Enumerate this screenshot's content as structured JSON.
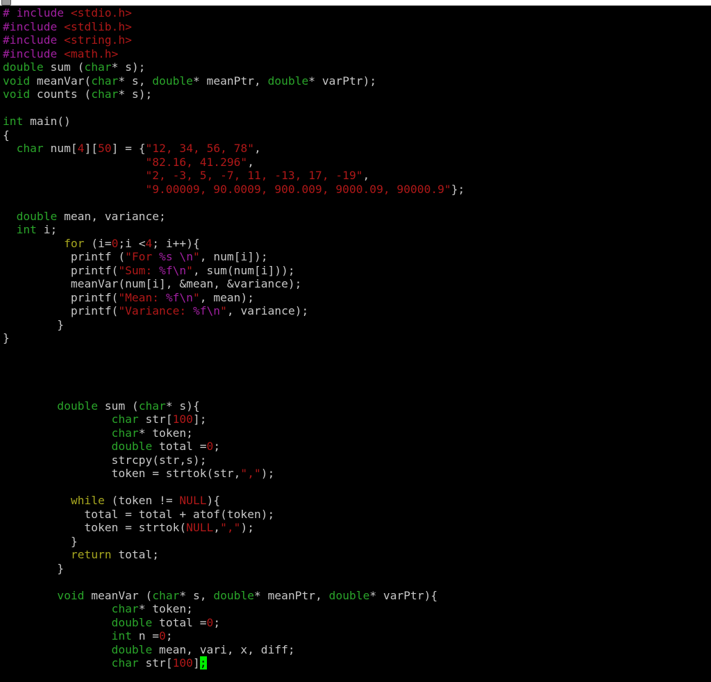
{
  "window": {
    "title": "",
    "app_icon": "terminal-window-icon"
  },
  "editor": {
    "theme_colors": {
      "background": "#000000",
      "text": "#c8c8c8",
      "type": "#2aa52a",
      "preproc": "#a020a0",
      "string": "#b01818",
      "special": "#a020a0",
      "keyword": "#a8a820",
      "cursor": "#00ee00"
    },
    "cursor": {
      "line": 49,
      "column": 26,
      "char": ";"
    },
    "lines": [
      [
        [
          "preproc",
          "# include "
        ],
        [
          "string",
          "<stdio.h>"
        ]
      ],
      [
        [
          "preproc",
          "#include "
        ],
        [
          "string",
          "<stdlib.h>"
        ]
      ],
      [
        [
          "preproc",
          "#include "
        ],
        [
          "string",
          "<string.h>"
        ]
      ],
      [
        [
          "preproc",
          "#include "
        ],
        [
          "string",
          "<math.h>"
        ]
      ],
      [
        [
          "type",
          "double"
        ],
        [
          "text",
          " sum ("
        ],
        [
          "type",
          "char"
        ],
        [
          "text",
          "* s);"
        ]
      ],
      [
        [
          "type",
          "void"
        ],
        [
          "text",
          " meanVar("
        ],
        [
          "type",
          "char"
        ],
        [
          "text",
          "* s, "
        ],
        [
          "type",
          "double"
        ],
        [
          "text",
          "* meanPtr, "
        ],
        [
          "type",
          "double"
        ],
        [
          "text",
          "* varPtr);"
        ]
      ],
      [
        [
          "type",
          "void"
        ],
        [
          "text",
          " counts ("
        ],
        [
          "type",
          "char"
        ],
        [
          "text",
          "* s);"
        ]
      ],
      [],
      [
        [
          "type",
          "int"
        ],
        [
          "text",
          " main()"
        ]
      ],
      [
        [
          "text",
          "{"
        ]
      ],
      [
        [
          "text",
          "  "
        ],
        [
          "type",
          "char"
        ],
        [
          "text",
          " num["
        ],
        [
          "number",
          "4"
        ],
        [
          "text",
          "]["
        ],
        [
          "number",
          "50"
        ],
        [
          "text",
          "] = {"
        ],
        [
          "string",
          "\"12, 34, 56, 78\""
        ],
        [
          "text",
          ","
        ]
      ],
      [
        [
          "text",
          "                     "
        ],
        [
          "string",
          "\"82.16, 41.296\""
        ],
        [
          "text",
          ","
        ]
      ],
      [
        [
          "text",
          "                     "
        ],
        [
          "string",
          "\"2, -3, 5, -7, 11, -13, 17, -19\""
        ],
        [
          "text",
          ","
        ]
      ],
      [
        [
          "text",
          "                     "
        ],
        [
          "string",
          "\"9.00009, 90.0009, 900.009, 9000.09, 90000.9\""
        ],
        [
          "text",
          "};"
        ]
      ],
      [],
      [
        [
          "text",
          "  "
        ],
        [
          "type",
          "double"
        ],
        [
          "text",
          " mean, variance;"
        ]
      ],
      [
        [
          "text",
          "  "
        ],
        [
          "type",
          "int"
        ],
        [
          "text",
          " i;"
        ]
      ],
      [
        [
          "text",
          "         "
        ],
        [
          "keyword",
          "for"
        ],
        [
          "text",
          " (i="
        ],
        [
          "number",
          "0"
        ],
        [
          "text",
          ";i <"
        ],
        [
          "number",
          "4"
        ],
        [
          "text",
          "; i++){"
        ]
      ],
      [
        [
          "text",
          "          printf ("
        ],
        [
          "string",
          "\"For "
        ],
        [
          "special",
          "%s"
        ],
        [
          "string",
          " "
        ],
        [
          "special",
          "\\n"
        ],
        [
          "string",
          "\""
        ],
        [
          "text",
          ", num[i]);"
        ]
      ],
      [
        [
          "text",
          "          printf("
        ],
        [
          "string",
          "\"Sum: "
        ],
        [
          "special",
          "%f\\n"
        ],
        [
          "string",
          "\""
        ],
        [
          "text",
          ", sum(num[i]));"
        ]
      ],
      [
        [
          "text",
          "          meanVar(num[i], &mean, &variance);"
        ]
      ],
      [
        [
          "text",
          "          printf("
        ],
        [
          "string",
          "\"Mean: "
        ],
        [
          "special",
          "%f\\n"
        ],
        [
          "string",
          "\""
        ],
        [
          "text",
          ", mean);"
        ]
      ],
      [
        [
          "text",
          "          printf("
        ],
        [
          "string",
          "\"Variance: "
        ],
        [
          "special",
          "%f\\n"
        ],
        [
          "string",
          "\""
        ],
        [
          "text",
          ", variance);"
        ]
      ],
      [
        [
          "text",
          "        }"
        ]
      ],
      [
        [
          "text",
          "}"
        ]
      ],
      [],
      [],
      [],
      [],
      [
        [
          "text",
          "        "
        ],
        [
          "type",
          "double"
        ],
        [
          "text",
          " sum ("
        ],
        [
          "type",
          "char"
        ],
        [
          "text",
          "* s){"
        ]
      ],
      [
        [
          "text",
          "                "
        ],
        [
          "type",
          "char"
        ],
        [
          "text",
          " str["
        ],
        [
          "number",
          "100"
        ],
        [
          "text",
          "];"
        ]
      ],
      [
        [
          "text",
          "                "
        ],
        [
          "type",
          "char"
        ],
        [
          "text",
          "* token;"
        ]
      ],
      [
        [
          "text",
          "                "
        ],
        [
          "type",
          "double"
        ],
        [
          "text",
          " total ="
        ],
        [
          "number",
          "0"
        ],
        [
          "text",
          ";"
        ]
      ],
      [
        [
          "text",
          "                strcpy(str,s);"
        ]
      ],
      [
        [
          "text",
          "                token = strtok(str,"
        ],
        [
          "string",
          "\",\""
        ],
        [
          "text",
          ");"
        ]
      ],
      [],
      [
        [
          "text",
          "          "
        ],
        [
          "keyword",
          "while"
        ],
        [
          "text",
          " (token != "
        ],
        [
          "const",
          "NULL"
        ],
        [
          "text",
          "){"
        ]
      ],
      [
        [
          "text",
          "            total = total + atof(token);"
        ]
      ],
      [
        [
          "text",
          "            token = strtok("
        ],
        [
          "const",
          "NULL"
        ],
        [
          "text",
          ","
        ],
        [
          "string",
          "\",\""
        ],
        [
          "text",
          ");"
        ]
      ],
      [
        [
          "text",
          "          }"
        ]
      ],
      [
        [
          "text",
          "          "
        ],
        [
          "keyword",
          "return"
        ],
        [
          "text",
          " total;"
        ]
      ],
      [
        [
          "text",
          "        }"
        ]
      ],
      [],
      [
        [
          "text",
          "        "
        ],
        [
          "type",
          "void"
        ],
        [
          "text",
          " meanVar ("
        ],
        [
          "type",
          "char"
        ],
        [
          "text",
          "* s, "
        ],
        [
          "type",
          "double"
        ],
        [
          "text",
          "* meanPtr, "
        ],
        [
          "type",
          "double"
        ],
        [
          "text",
          "* varPtr){"
        ]
      ],
      [
        [
          "text",
          "                "
        ],
        [
          "type",
          "char"
        ],
        [
          "text",
          "* token;"
        ]
      ],
      [
        [
          "text",
          "                "
        ],
        [
          "type",
          "double"
        ],
        [
          "text",
          " total ="
        ],
        [
          "number",
          "0"
        ],
        [
          "text",
          ";"
        ]
      ],
      [
        [
          "text",
          "                "
        ],
        [
          "type",
          "int"
        ],
        [
          "text",
          " n ="
        ],
        [
          "number",
          "0"
        ],
        [
          "text",
          ";"
        ]
      ],
      [
        [
          "text",
          "                "
        ],
        [
          "type",
          "double"
        ],
        [
          "text",
          " mean, vari, x, diff;"
        ]
      ],
      [
        [
          "text",
          "                "
        ],
        [
          "type",
          "char"
        ],
        [
          "text",
          " str["
        ],
        [
          "number",
          "100"
        ],
        [
          "text",
          "]"
        ],
        [
          "cursor",
          ";"
        ]
      ]
    ]
  }
}
